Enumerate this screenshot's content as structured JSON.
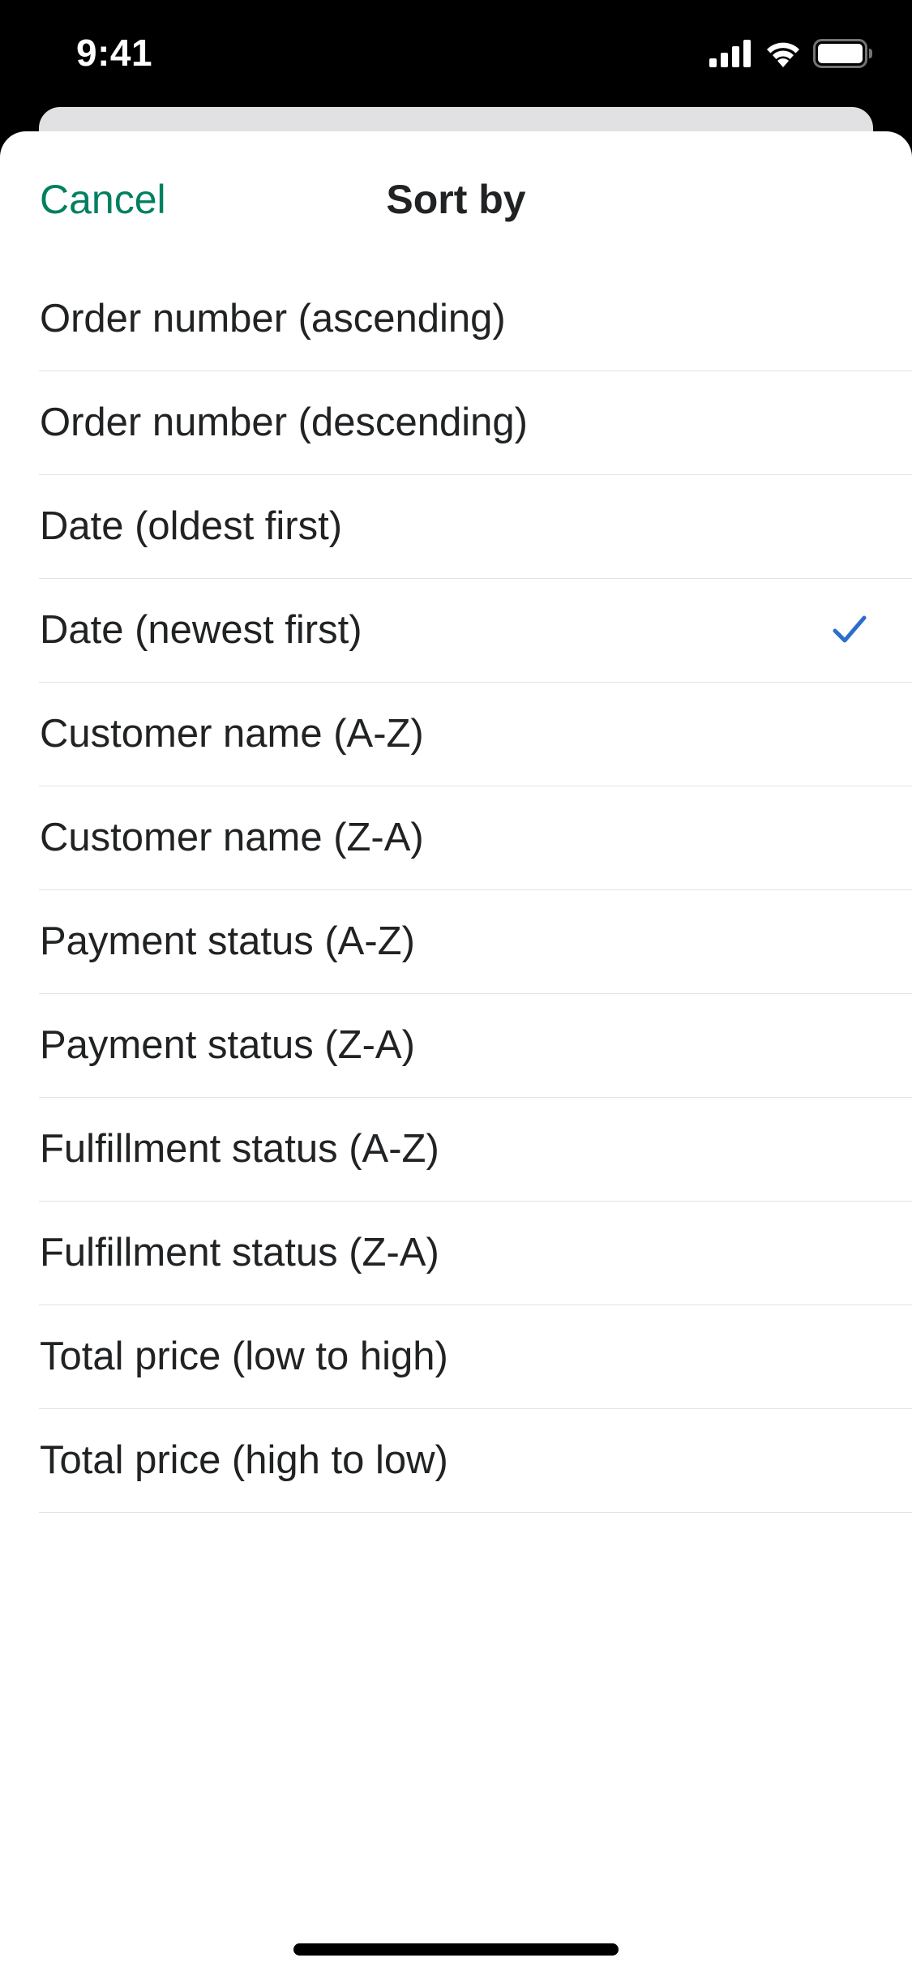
{
  "status_bar": {
    "time": "9:41",
    "icons": [
      "cellular-signal-icon",
      "wifi-icon",
      "battery-icon"
    ]
  },
  "sheet": {
    "cancel_label": "Cancel",
    "title": "Sort by",
    "selected_index": 3,
    "options": [
      {
        "label": "Order number (ascending)",
        "selected": false
      },
      {
        "label": "Order number (descending)",
        "selected": false
      },
      {
        "label": "Date (oldest first)",
        "selected": false
      },
      {
        "label": "Date (newest first)",
        "selected": true
      },
      {
        "label": "Customer name (A-Z)",
        "selected": false
      },
      {
        "label": "Customer name (Z-A)",
        "selected": false
      },
      {
        "label": "Payment status (A-Z)",
        "selected": false
      },
      {
        "label": "Payment status (Z-A)",
        "selected": false
      },
      {
        "label": "Fulfillment status (A-Z)",
        "selected": false
      },
      {
        "label": "Fulfillment status (Z-A)",
        "selected": false
      },
      {
        "label": "Total price (low to high)",
        "selected": false
      },
      {
        "label": "Total price (high to low)",
        "selected": false
      }
    ]
  },
  "colors": {
    "accent": "#008060",
    "check": "#2c6ecb",
    "text": "#202223",
    "divider": "#e1e3e5"
  }
}
